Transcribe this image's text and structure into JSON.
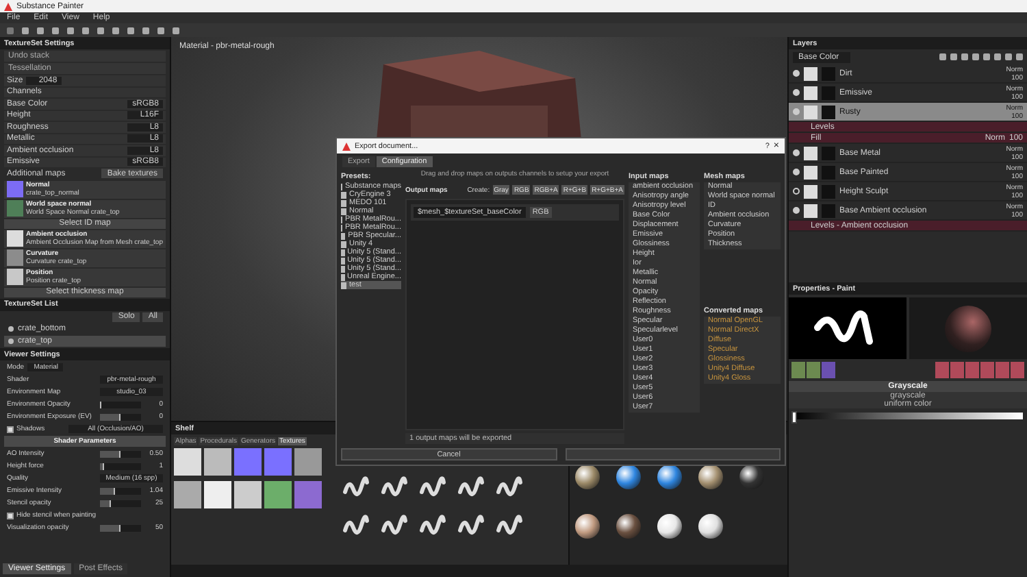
{
  "window": {
    "title": "Substance Painter"
  },
  "menu": [
    "File",
    "Edit",
    "View",
    "Help"
  ],
  "texture_set_settings": {
    "title": "TextureSet Settings",
    "fields": [
      "Undo stack",
      "Tessellation"
    ],
    "size_label": "Size",
    "size": "2048",
    "channels_label": "Channels",
    "channels": [
      {
        "name": "Base Color",
        "format": "sRGB8"
      },
      {
        "name": "Height",
        "format": "L16F"
      },
      {
        "name": "Roughness",
        "format": "L8"
      },
      {
        "name": "Metallic",
        "format": "L8"
      },
      {
        "name": "Ambient occlusion",
        "format": "L8"
      },
      {
        "name": "Emissive",
        "format": "sRGB8"
      }
    ],
    "additional_maps_label": "Additional maps",
    "bake_button": "Bake textures",
    "maps": [
      {
        "kind": "map",
        "name": "Normal",
        "source": "crate_top_normal",
        "color": "#7c6cf4"
      },
      {
        "kind": "map",
        "name": "World space normal",
        "source": "World Space Normal crate_top",
        "color": "#4f7f58"
      },
      {
        "kind": "button",
        "name": "Select ID map"
      },
      {
        "kind": "map",
        "name": "Ambient occlusion",
        "source": "Ambient Occlusion Map from Mesh crate_top",
        "color": "#dcdcdc"
      },
      {
        "kind": "map",
        "name": "Curvature",
        "source": "Curvature crate_top",
        "color": "#8c8c8c"
      },
      {
        "kind": "map",
        "name": "Position",
        "source": "Position crate_top",
        "color": "#c8c8c8"
      },
      {
        "kind": "button",
        "name": "Select thickness map"
      }
    ]
  },
  "texture_set_list": {
    "title": "TextureSet List",
    "buttons": [
      "Solo",
      "All"
    ],
    "items": [
      {
        "name": "crate_bottom",
        "selected": false
      },
      {
        "name": "crate_top",
        "selected": true
      }
    ]
  },
  "viewer_settings": {
    "title": "Viewer Settings",
    "mode_label": "Mode",
    "mode": "Material",
    "rows": [
      {
        "kind": "select",
        "label": "Shader",
        "value": "pbr-metal-rough"
      },
      {
        "kind": "select",
        "label": "Environment Map",
        "value": "studio_03"
      },
      {
        "kind": "slider",
        "label": "Environment Opacity",
        "value": "0",
        "level": 0.0
      },
      {
        "kind": "slider",
        "label": "Environment Exposure (EV)",
        "value": "0",
        "level": 0.5
      },
      {
        "kind": "check",
        "label": "Shadows",
        "checked": true,
        "value": "All (Occlusion/AO)"
      },
      {
        "kind": "header",
        "label": "Shader Parameters"
      },
      {
        "kind": "slider",
        "label": "AO Intensity",
        "value": "0.50",
        "level": 0.5
      },
      {
        "kind": "slider",
        "label": "Height force",
        "value": "1",
        "level": 0.1
      },
      {
        "kind": "select",
        "label": "Quality",
        "value": "Medium (16 spp)"
      },
      {
        "kind": "slider",
        "label": "Emissive Intensity",
        "value": "1.04",
        "level": 0.35
      },
      {
        "kind": "slider",
        "label": "Stencil opacity",
        "value": "25",
        "level": 0.25
      },
      {
        "kind": "check",
        "label": "Hide stencil when painting",
        "checked": true
      },
      {
        "kind": "slider",
        "label": "Visualization opacity",
        "value": "50",
        "level": 0.5
      }
    ],
    "tabs": [
      {
        "label": "Viewer Settings",
        "selected": true
      },
      {
        "label": "Post Effects",
        "selected": false
      }
    ]
  },
  "viewport": {
    "label": "Material - pbr-metal-rough"
  },
  "export_dialog": {
    "title": "Export document...",
    "help": "?",
    "close": "×",
    "tabs": [
      {
        "label": "Export",
        "selected": false
      },
      {
        "label": "Configuration",
        "selected": true
      }
    ],
    "presets_label": "Presets:",
    "presets": [
      {
        "name": "Substance maps",
        "selected": false
      },
      {
        "name": "CryEngine 3",
        "selected": false
      },
      {
        "name": "MEDO 101",
        "selected": false
      },
      {
        "name": "Normal",
        "selected": false
      },
      {
        "name": "PBR MetalRou...",
        "selected": false
      },
      {
        "name": "PBR MetalRou...",
        "selected": false
      },
      {
        "name": "PBR Specular...",
        "selected": false
      },
      {
        "name": "Unity 4",
        "selected": false
      },
      {
        "name": "Unity 5 (Stand...",
        "selected": false
      },
      {
        "name": "Unity 5 (Stand...",
        "selected": false
      },
      {
        "name": "Unity 5 (Stand...",
        "selected": false
      },
      {
        "name": "Unreal Engine...",
        "selected": false
      },
      {
        "name": "test",
        "selected": true
      }
    ],
    "hint": "Drag and drop maps on outputs channels to setup your export",
    "output_label": "Output maps",
    "create_label": "Create:",
    "create_buttons": [
      "Gray",
      "RGB",
      "RGB+A",
      "R+G+B",
      "R+G+B+A"
    ],
    "outputs": [
      {
        "name": "$mesh_$textureSet_baseColor",
        "channel": "RGB"
      }
    ],
    "input_label": "Input maps",
    "inputs": [
      "ambient occlusion",
      "Anisotropy angle",
      "Anisotropy level",
      "Base Color",
      "Displacement",
      "Emissive",
      "Glossiness",
      "Height",
      "Ior",
      "Metallic",
      "Normal",
      "Opacity",
      "Reflection",
      "Roughness",
      "Specular",
      "Specularlevel",
      "User0",
      "User1",
      "User2",
      "User3",
      "User4",
      "User5",
      "User6",
      "User7"
    ],
    "mesh_label": "Mesh maps",
    "mesh_maps": [
      "Normal",
      "World space normal",
      "ID",
      "Ambient occlusion",
      "Curvature",
      "Position",
      "Thickness"
    ],
    "converted_label": "Converted maps",
    "converted_maps": [
      "Normal OpenGL",
      "Normal DirectX",
      "Diffuse",
      "Specular",
      "Glossiness",
      "Unity4 Diffuse",
      "Unity4 Gloss"
    ],
    "footer": "1 output maps will be exported",
    "cancel": "Cancel"
  },
  "shelf": {
    "title": "Shelf",
    "tabs": [
      {
        "label": "Alphas",
        "selected": false
      },
      {
        "label": "Procedurals",
        "selected": false
      },
      {
        "label": "Generators",
        "selected": false
      },
      {
        "label": "Textures",
        "selected": true
      }
    ]
  },
  "layers": {
    "title": "Layers",
    "channel": "Base Color",
    "items": [
      {
        "name": "Dirt",
        "blend": "Norm",
        "opacity": "100",
        "visible": true,
        "selected": false
      },
      {
        "name": "Emissive",
        "blend": "Norm",
        "opacity": "100",
        "visible": true,
        "selected": false
      },
      {
        "name": "Rusty",
        "blend": "Norm",
        "opacity": "100",
        "visible": true,
        "selected": true,
        "effects": [
          {
            "name": "Levels"
          },
          {
            "name": "Fill",
            "blend": "Norm",
            "opacity": "100"
          }
        ]
      },
      {
        "name": "Base Metal",
        "blend": "Norm",
        "opacity": "100",
        "visible": true,
        "selected": false
      },
      {
        "name": "Base Painted",
        "blend": "Norm",
        "opacity": "100",
        "visible": true,
        "selected": false
      },
      {
        "name": "Height Sculpt",
        "blend": "Norm",
        "opacity": "100",
        "visible": false,
        "selected": false
      },
      {
        "name": "Base Ambient occlusion",
        "blend": "Norm",
        "opacity": "100",
        "visible": true,
        "selected": false,
        "effects": [
          {
            "name": "Levels - Ambient occlusion"
          }
        ]
      }
    ]
  },
  "properties": {
    "title": "Properties - Paint",
    "section": "Grayscale",
    "value": "grayscale",
    "hint": "uniform color",
    "level": 0.0
  }
}
